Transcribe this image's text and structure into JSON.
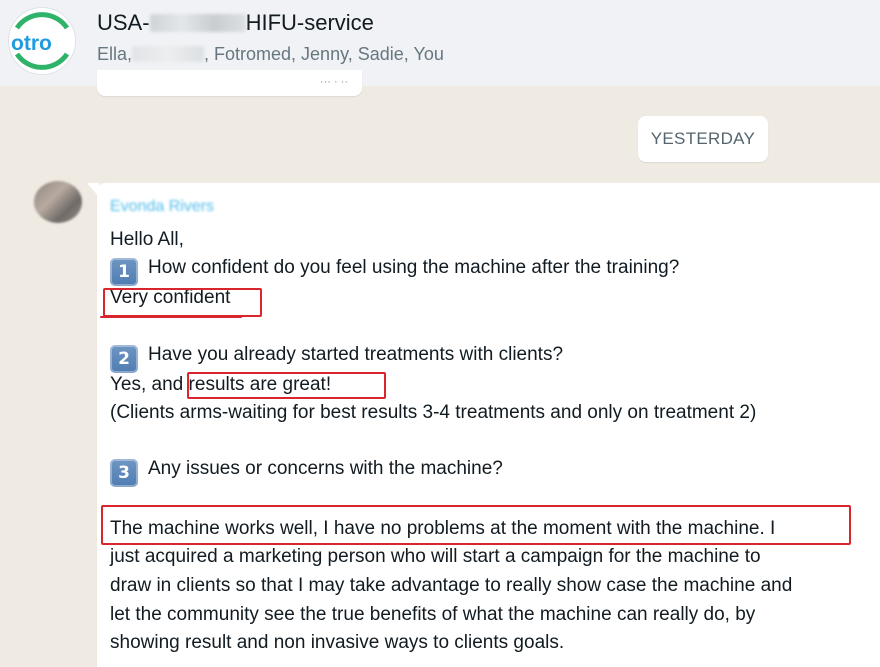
{
  "header": {
    "title_prefix": "USA-",
    "title_suffix": "HIFU-service",
    "subtitle_prefix": "Ella,",
    "subtitle_suffix": ", Fotromed, Jenny, Sadie, You",
    "avatar_text": "otro",
    "avatar_color": "#1f9be0"
  },
  "date_divider": "YESTERDAY",
  "message": {
    "sender": "Evonda Rivers",
    "greeting": "Hello All,",
    "q1_number": "1",
    "q1_text": "How confident do you feel using the machine after the training?",
    "a1": "Very confident",
    "q2_number": "2",
    "q2_text": "Have you already started treatments with clients?",
    "a2_prefix": "Yes, and ",
    "a2_highlight": "results are great!",
    "a2_note": "(Clients arms-waiting for best results 3-4 treatments and only on treatment 2)",
    "q3_number": "3",
    "q3_text": "Any issues or concerns with the machine?",
    "a3_line1": "The machine works well, I have no problems at the moment with the machine. I",
    "a3_line2": "just acquired a marketing person who will start a campaign for the machine to",
    "a3_line3": "draw in clients so that I may take advantage to really show case the machine and",
    "a3_line4": "let the community see the true benefits of what the machine can really do, by",
    "a3_line5": "showing result and non invasive ways to clients goals."
  },
  "colors": {
    "highlight_box": "#d9262c",
    "sender_name": "#53bdeb",
    "keycap": "#5a86ba"
  }
}
